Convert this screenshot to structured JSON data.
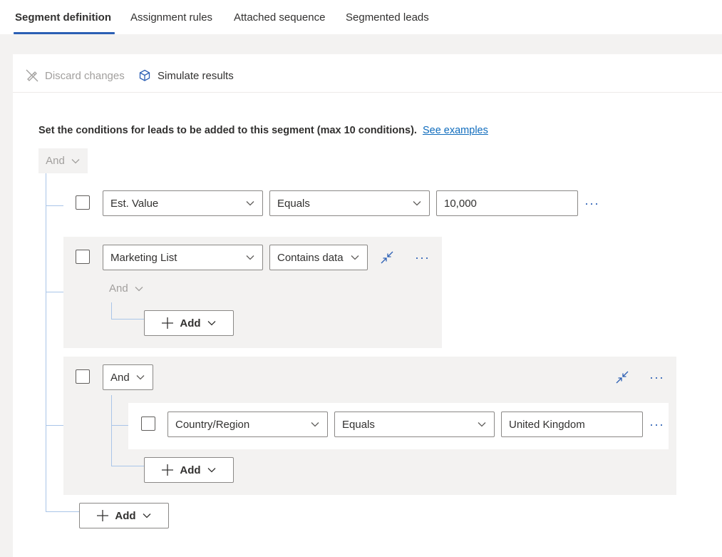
{
  "tabs": [
    {
      "label": "Segment definition"
    },
    {
      "label": "Assignment rules"
    },
    {
      "label": "Attached sequence"
    },
    {
      "label": "Segmented leads"
    }
  ],
  "toolbar": {
    "discard_label": "Discard changes",
    "simulate_label": "Simulate results"
  },
  "description": {
    "text": "Set the conditions for leads to be added to this segment (max 10 conditions).",
    "link": "See examples"
  },
  "root": {
    "operator": "And",
    "add_label": "Add"
  },
  "condition1": {
    "field": "Est. Value",
    "operator": "Equals",
    "value": "10,000"
  },
  "group1": {
    "field": "Marketing List",
    "operator": "Contains data",
    "inner_operator": "And",
    "add_label": "Add"
  },
  "group2": {
    "operator": "And",
    "add_label": "Add",
    "condition": {
      "field": "Country/Region",
      "operator": "Equals",
      "value": "United Kingdom"
    }
  },
  "colors": {
    "accent": "#2b5fb4",
    "connector": "#a9c5e8",
    "group_bg": "#f3f2f1"
  }
}
